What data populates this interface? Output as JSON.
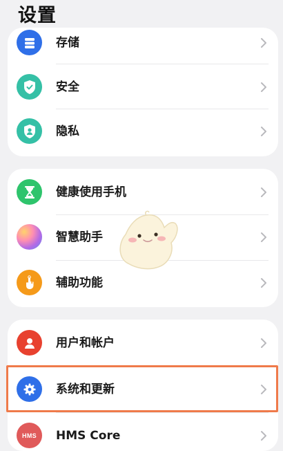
{
  "header": {
    "title": "设置"
  },
  "group1": {
    "items": [
      {
        "label": "存储",
        "icon": "storage-icon",
        "color": "#2f6fe8"
      },
      {
        "label": "安全",
        "icon": "shield-check-icon",
        "color": "#35c0a6"
      },
      {
        "label": "隐私",
        "icon": "privacy-icon",
        "color": "#35c0a6"
      }
    ]
  },
  "group2": {
    "items": [
      {
        "label": "健康使用手机",
        "icon": "hourglass-icon",
        "color": "#2ec46c"
      },
      {
        "label": "智慧助手",
        "icon": "smart-assistant-icon",
        "color": "#b36ae6"
      },
      {
        "label": "辅助功能",
        "icon": "accessibility-hand-icon",
        "color": "#f59a1a"
      }
    ]
  },
  "group3": {
    "items": [
      {
        "label": "用户和帐户",
        "icon": "user-icon",
        "color": "#e8412f"
      },
      {
        "label": "系统和更新",
        "icon": "system-gear-icon",
        "color": "#2f6fe8"
      },
      {
        "label": "HMS Core",
        "icon": "hms-icon",
        "color": "#e05a5a",
        "icon_text": "HMS"
      }
    ]
  },
  "highlight_color": "#ef7a4a"
}
